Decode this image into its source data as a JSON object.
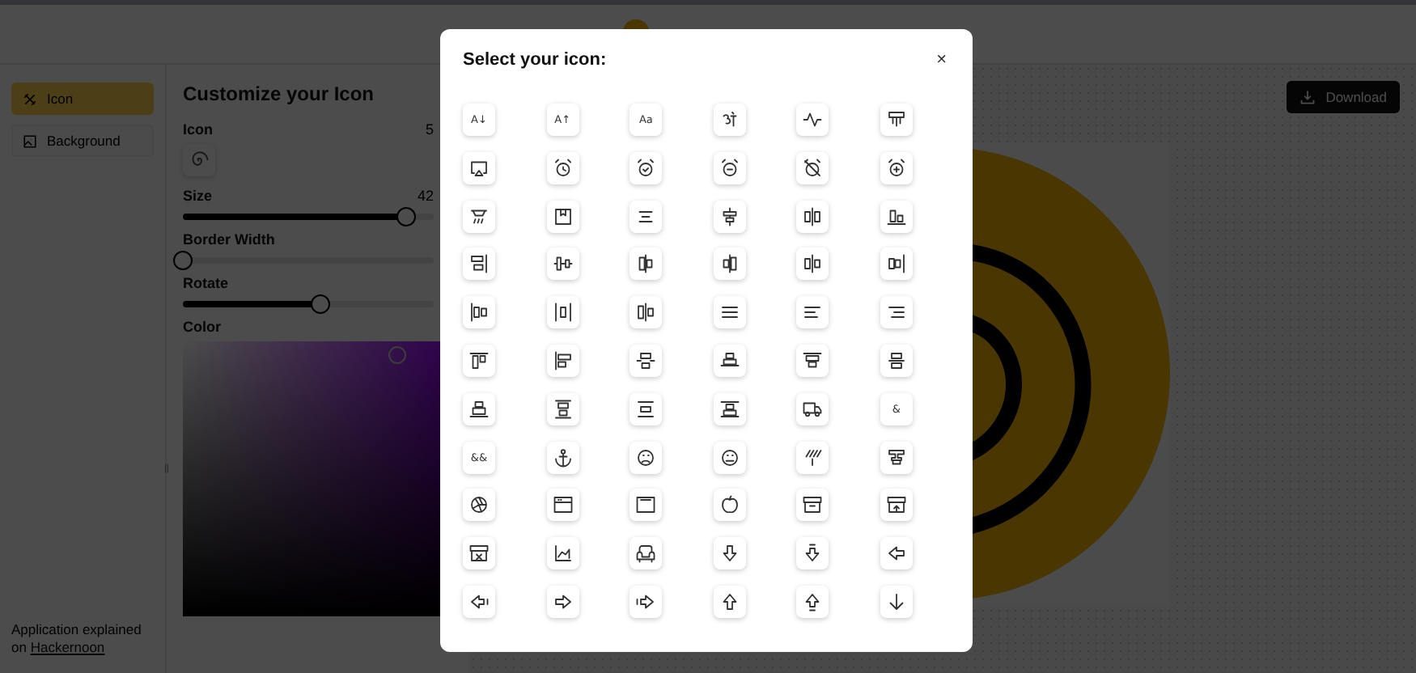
{
  "sidebar": {
    "items": [
      {
        "label": "Icon",
        "selected": true
      },
      {
        "label": "Background",
        "selected": false
      }
    ],
    "footer": {
      "text": "Application explained on",
      "link": "Hackernoon"
    }
  },
  "panel": {
    "title": "Customize your Icon",
    "controls": [
      {
        "kind": "icon",
        "label": "Icon",
        "reading": "5"
      },
      {
        "kind": "slider",
        "label": "Size",
        "reading": "42",
        "level": 0.89
      },
      {
        "kind": "slider",
        "label": "Border Width",
        "level": 0
      },
      {
        "kind": "slider",
        "label": "Rotate",
        "level": 0.55
      },
      {
        "kind": "color",
        "label": "Color"
      }
    ]
  },
  "canvas": {
    "download_button": "Download"
  },
  "modal": {
    "title": "Select your icon:",
    "close": "×",
    "icons": [
      {
        "kind": "glyph",
        "text": "A↓"
      },
      {
        "kind": "glyph",
        "text": "A↑"
      },
      {
        "kind": "glyph",
        "text": "Aa"
      },
      {
        "kind": "drawing"
      },
      {
        "kind": "drawing"
      },
      {
        "kind": "drawing"
      },
      {
        "kind": "drawing"
      },
      {
        "kind": "drawing"
      },
      {
        "kind": "drawing"
      },
      {
        "kind": "drawing"
      },
      {
        "kind": "drawing"
      },
      {
        "kind": "drawing"
      },
      {
        "kind": "drawing"
      },
      {
        "kind": "drawing"
      },
      {
        "kind": "drawing"
      },
      {
        "kind": "drawing"
      },
      {
        "kind": "drawing"
      },
      {
        "kind": "drawing"
      },
      {
        "kind": "drawing"
      },
      {
        "kind": "drawing"
      },
      {
        "kind": "drawing"
      },
      {
        "kind": "drawing"
      },
      {
        "kind": "drawing"
      },
      {
        "kind": "drawing"
      },
      {
        "kind": "drawing"
      },
      {
        "kind": "drawing"
      },
      {
        "kind": "drawing"
      },
      {
        "kind": "drawing"
      },
      {
        "kind": "drawing"
      },
      {
        "kind": "drawing"
      },
      {
        "kind": "drawing"
      },
      {
        "kind": "drawing"
      },
      {
        "kind": "drawing"
      },
      {
        "kind": "drawing"
      },
      {
        "kind": "drawing"
      },
      {
        "kind": "drawing"
      },
      {
        "kind": "drawing"
      },
      {
        "kind": "drawing"
      },
      {
        "kind": "drawing"
      },
      {
        "kind": "drawing"
      },
      {
        "kind": "drawing"
      },
      {
        "kind": "glyph",
        "text": "&"
      },
      {
        "kind": "glyph",
        "text": "&&"
      },
      {
        "kind": "drawing"
      },
      {
        "kind": "drawing"
      },
      {
        "kind": "drawing"
      },
      {
        "kind": "drawing"
      },
      {
        "kind": "drawing"
      },
      {
        "kind": "drawing"
      },
      {
        "kind": "drawing"
      },
      {
        "kind": "drawing"
      },
      {
        "kind": "drawing"
      },
      {
        "kind": "drawing"
      },
      {
        "kind": "drawing"
      },
      {
        "kind": "drawing"
      },
      {
        "kind": "drawing"
      },
      {
        "kind": "drawing"
      },
      {
        "kind": "drawing"
      },
      {
        "kind": "drawing"
      },
      {
        "kind": "drawing"
      },
      {
        "kind": "drawing"
      },
      {
        "kind": "drawing"
      },
      {
        "kind": "drawing"
      },
      {
        "kind": "drawing"
      },
      {
        "kind": "drawing"
      },
      {
        "kind": "drawing"
      }
    ]
  }
}
